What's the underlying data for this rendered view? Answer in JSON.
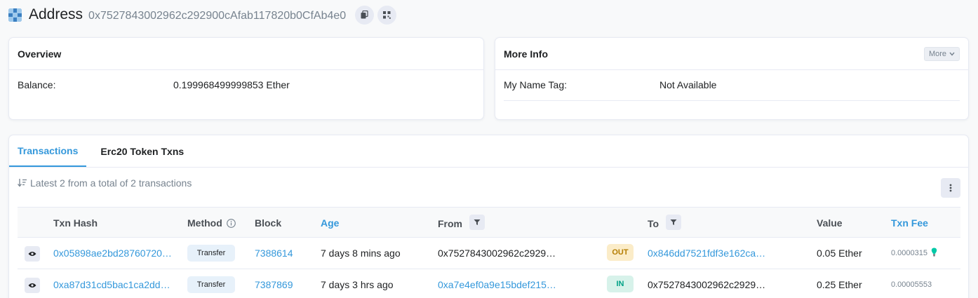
{
  "header": {
    "title": "Address",
    "address": "0x7527843002962c292900cAfab117820b0CfAb4e0"
  },
  "overview": {
    "title": "Overview",
    "balance_label": "Balance:",
    "balance_value": "0.199968499999853 Ether"
  },
  "more_info": {
    "title": "More Info",
    "more_button": "More",
    "name_tag_label": "My Name Tag:",
    "name_tag_value": "Not Available"
  },
  "tabs": [
    {
      "label": "Transactions",
      "active": true
    },
    {
      "label": "Erc20 Token Txns",
      "active": false
    }
  ],
  "summary": "Latest 2 from a total of 2 transactions",
  "columns": {
    "txn_hash": "Txn Hash",
    "method": "Method",
    "block": "Block",
    "age": "Age",
    "from": "From",
    "to": "To",
    "value": "Value",
    "txn_fee": "Txn Fee"
  },
  "transactions": [
    {
      "hash": "0x05898ae2bd28760720…",
      "method": "Transfer",
      "block": "7388614",
      "age": "7 days 8 mins ago",
      "from": "0x7527843002962c2929…",
      "direction": "OUT",
      "to": "0x846dd7521fdf3e162ca…",
      "value": "0.05 Ether",
      "fee": "0.0000315"
    },
    {
      "hash": "0xa87d31cd5bac1ca2dd…",
      "method": "Transfer",
      "block": "7387869",
      "age": "7 days 3 hrs ago",
      "from": "0xa7e4ef0a9e15bdef215…",
      "direction": "IN",
      "to": "0x7527843002962c2929…",
      "value": "0.25 Ether",
      "fee": "0.00005553"
    }
  ],
  "colors": {
    "accent": "#3498db",
    "out_badge": "#fbecc8",
    "in_badge": "#d7f2ea"
  }
}
